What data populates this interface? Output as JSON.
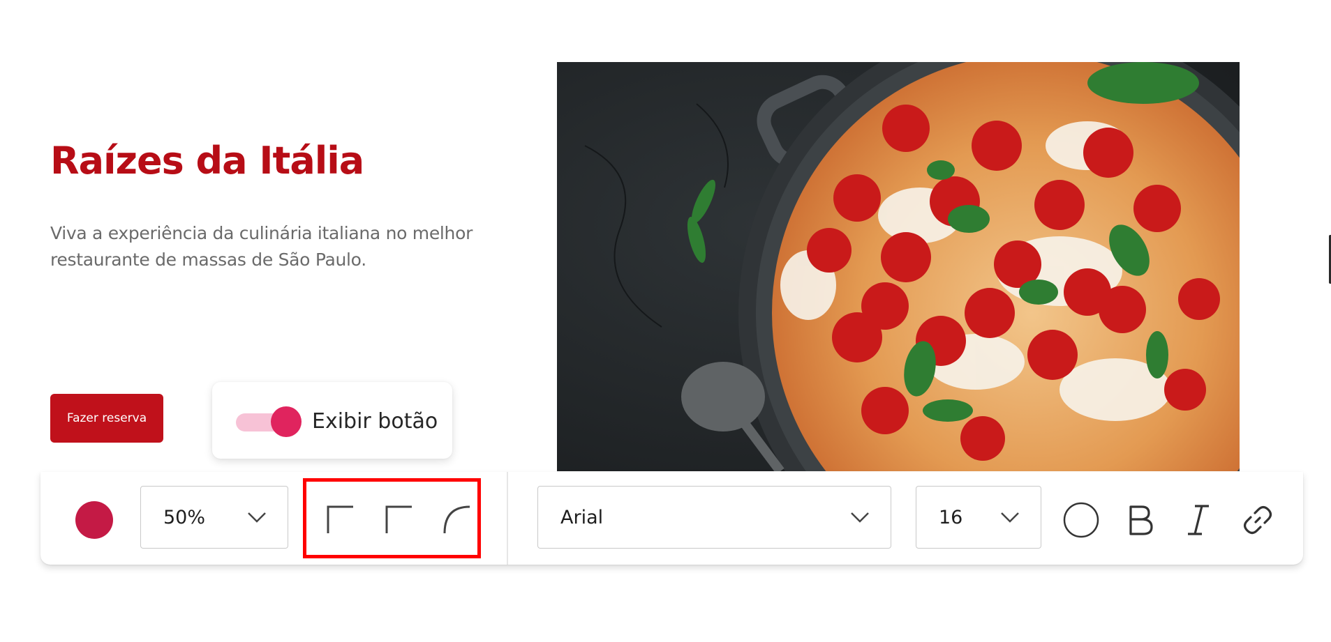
{
  "hero": {
    "title": "Raízes da Itália",
    "subtitle": "Viva a experiência da culinária italiana no melhor restaurante de massas de São Paulo.",
    "cta_label": "Fazer reserva",
    "image_icon": "pasta-dish-image"
  },
  "toggle": {
    "label": "Exibir botão",
    "checked": true
  },
  "toolbar": {
    "opacity_value": "50%",
    "font_family_value": "Arial",
    "font_size_value": "16",
    "corner_icons": [
      "square-corner-icon",
      "square-corner-icon",
      "rounded-corner-icon"
    ],
    "tool_icons": [
      "circle-outline-icon",
      "bold-icon",
      "italic-icon",
      "link-icon"
    ]
  },
  "colors": {
    "title": "#b70d16",
    "subtitle": "#6a6a6a",
    "cta_bg": "#c0111b",
    "swatch": "#c41a45",
    "toggle_thumb": "#e0245e",
    "toggle_track": "#f7c2d6",
    "highlight": "#ff0000"
  }
}
